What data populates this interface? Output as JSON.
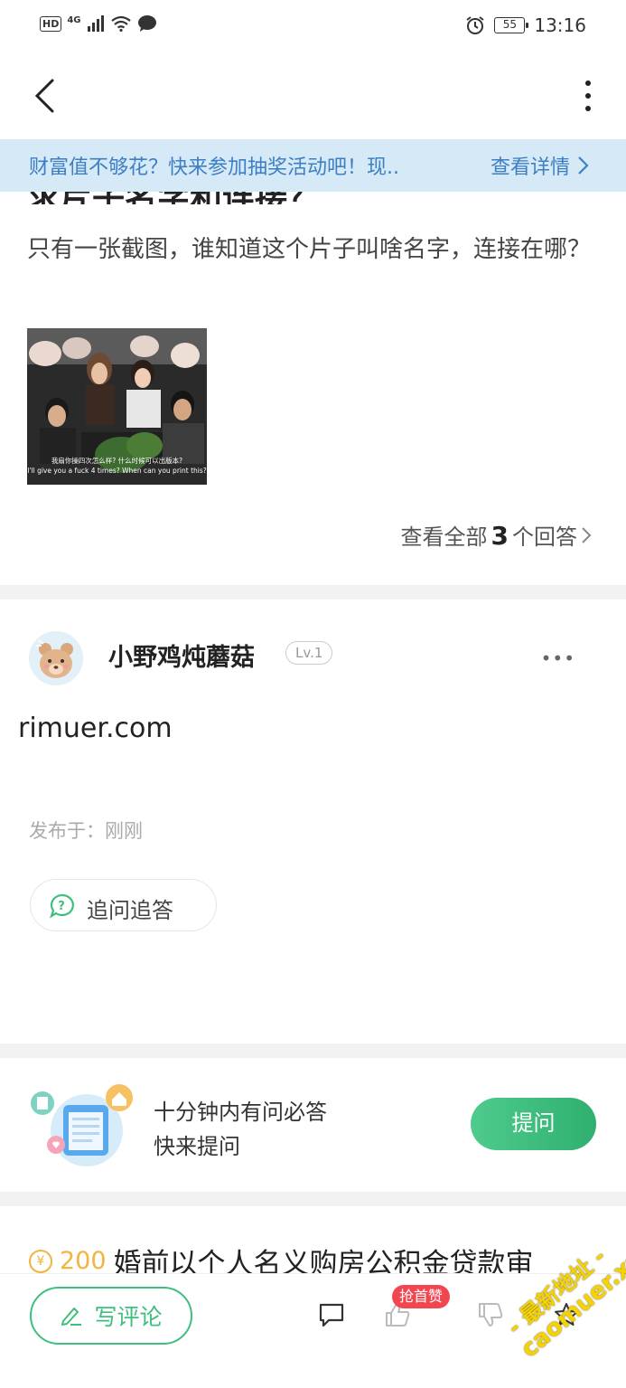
{
  "status_bar": {
    "hd": "HD",
    "network": "4G",
    "battery": "55",
    "time": "13:16"
  },
  "banner": {
    "message": "财富值不够花？快来参加抽奖活动吧！现..",
    "link_label": "查看详情"
  },
  "question": {
    "title_partial": "求片子名字和连接？",
    "body": "只有一张截图，谁知道这个片子叫啥名字，连接在哪？",
    "image_subtitle_cn": "我扇你操四次怎么样? 什么时候可以出版本?",
    "image_subtitle_en": "I'll give you a fuck 4 times? When can you print this?",
    "view_all_prefix": "查看全部",
    "view_all_count": "3",
    "view_all_suffix": "个回答"
  },
  "answer": {
    "username": "小野鸡炖蘑菇",
    "level": "Lv.1",
    "more": "•••",
    "content": "rimuer.com",
    "published": "发布于：刚刚",
    "followup_label": "追问追答"
  },
  "ask_card": {
    "line1": "十分钟内有问必答",
    "line2": "快来提问",
    "button_label": "提问"
  },
  "next_question": {
    "coin_symbol": "¥",
    "reward": "200",
    "title": "婚前以个人名义购房公积金贷款审"
  },
  "bottom_bar": {
    "write_comment_label": "写评论",
    "first_like_badge": "抢首赞"
  },
  "watermark": {
    "line1": "- 最新地址 -",
    "line2": "caomuer.xyz"
  },
  "colors": {
    "accent_green": "#3fbf7d",
    "banner_bg": "#d6e9f7",
    "banner_text": "#3d7fc3",
    "reward_gold": "#f2b440",
    "badge_red": "#f1464f"
  }
}
